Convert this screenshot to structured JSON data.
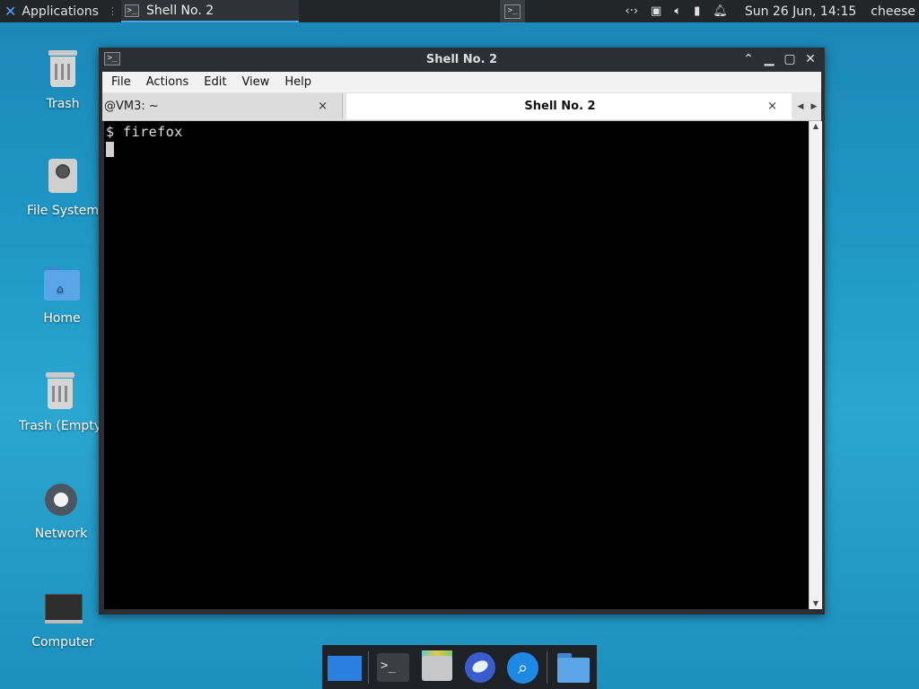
{
  "top_panel": {
    "apps_label": "Applications",
    "task_label": "Shell No. 2",
    "tray_icons": [
      "network-icon",
      "display-icon",
      "volume-icon",
      "battery-icon",
      "notification-icon"
    ],
    "clock": "Sun 26 Jun, 14:15",
    "user": "cheese"
  },
  "desktop": {
    "icons": [
      {
        "label": "Trash"
      },
      {
        "label": "File System"
      },
      {
        "label": "Home"
      },
      {
        "label": "Trash (Empty"
      },
      {
        "label": "Network"
      },
      {
        "label": "Computer"
      }
    ]
  },
  "window": {
    "title": "Shell No. 2",
    "menu": [
      "File",
      "Actions",
      "Edit",
      "View",
      "Help"
    ],
    "tabs": [
      {
        "label": "@VM3: ~",
        "close": "×"
      },
      {
        "label": "Shell No. 2",
        "close": "×"
      }
    ],
    "terminal_line": "$ firefox"
  },
  "dock": {
    "items": [
      "show-desktop",
      "terminal",
      "file-manager",
      "web-browser",
      "app-finder",
      "folder"
    ]
  },
  "colors": {
    "desktop_bg": "#1f98c6",
    "panel_bg": "#232629",
    "accent": "#4aa3df",
    "terminal_bg": "#000000"
  }
}
